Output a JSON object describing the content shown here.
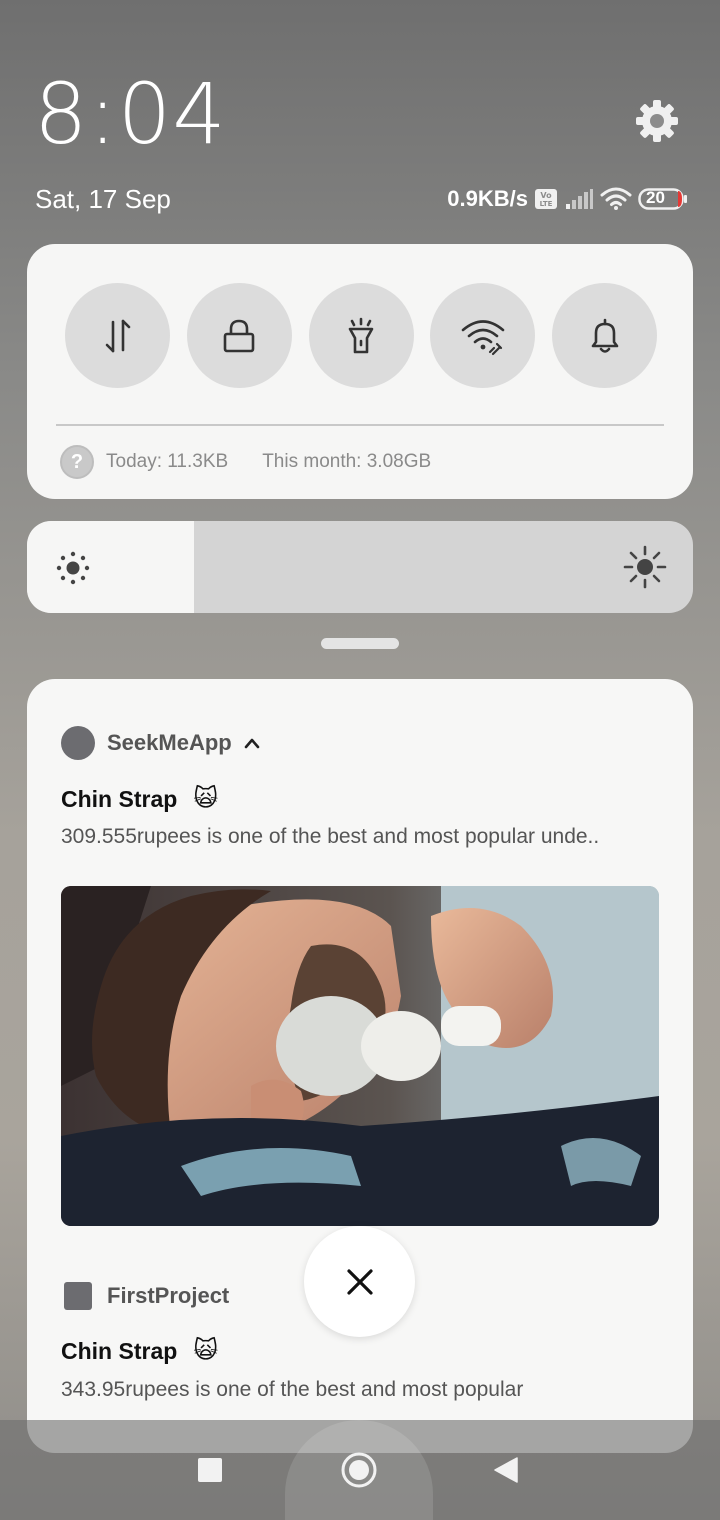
{
  "status_bar": {
    "time": "8:04",
    "date": "Sat, 17 Sep",
    "network_speed": "0.9KB/s",
    "volte_label": "Vo LTE",
    "battery_level": "20",
    "settings_icon": "gear-icon",
    "accent_battery": "#e53935"
  },
  "quick_settings": {
    "toggles": [
      {
        "name": "mobile-data",
        "icon": "data-transfer-icon"
      },
      {
        "name": "screen-lock",
        "icon": "lock-icon"
      },
      {
        "name": "flashlight",
        "icon": "flashlight-icon"
      },
      {
        "name": "wifi",
        "icon": "wifi-icon"
      },
      {
        "name": "ringer",
        "icon": "bell-icon"
      }
    ],
    "usage_help_icon": "?",
    "today_usage": "Today: 11.3KB",
    "month_usage": "This month: 3.08GB"
  },
  "brightness": {
    "level_fraction": 0.25
  },
  "notifications": [
    {
      "app_name": "SeekMeApp",
      "title": "Chin Strap",
      "emoji": "🙀",
      "body": "309.555rupees is one of the best and most popular unde..",
      "expanded": true,
      "image": "barber shaving a man's beard with a shaving brush"
    },
    {
      "app_name": "FirstProject",
      "title": "Chin Strap",
      "emoji": "🙀",
      "body": "343.95rupees is one of the best and most popular",
      "expanded": false
    }
  ],
  "dismiss_all_icon": "close-icon",
  "nav": {
    "recent": "recent-apps-icon",
    "home": "home-icon",
    "back": "back-icon"
  }
}
